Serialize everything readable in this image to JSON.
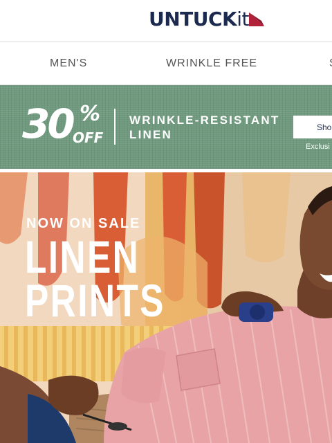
{
  "header": {
    "logo_text_main": "UNTUCK",
    "logo_text_it": "it",
    "logo_icon": "red-triangle-logo-mark"
  },
  "nav": {
    "items": [
      {
        "label": "MEN'S"
      },
      {
        "label": "WRINKLE FREE"
      },
      {
        "label": "S"
      }
    ]
  },
  "promo": {
    "percent": "30",
    "percent_sign": "%",
    "off": "OFF",
    "title": "WRINKLE-RESISTANT LINEN",
    "button_label": "Sho",
    "note": "Exclusi",
    "background_color": "#6f9a7e"
  },
  "hero": {
    "eyebrow": "NOW ON SALE",
    "title": "LINEN PRINTS",
    "image": "man-in-pink-striped-linen-shirt-smiling-on-chair"
  },
  "colors": {
    "brand_navy": "#1b2a4e",
    "brand_red": "#b3203a"
  }
}
